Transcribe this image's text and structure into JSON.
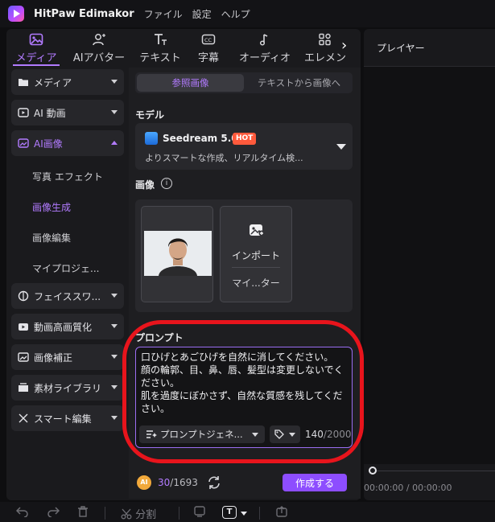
{
  "app": {
    "title": "HitPaw Edimakor",
    "menu": [
      "ファイル",
      "設定",
      "ヘルプ"
    ]
  },
  "tool_tabs": [
    {
      "label": "メディア",
      "icon": "media-icon",
      "active": true
    },
    {
      "label": "AIアバター",
      "icon": "ai-avatar-icon",
      "active": false
    },
    {
      "label": "テキスト",
      "icon": "text-icon",
      "active": false
    },
    {
      "label": "字幕",
      "icon": "subtitle-icon",
      "active": false
    },
    {
      "label": "オーディオ",
      "icon": "audio-icon",
      "active": false
    },
    {
      "label": "エレメン",
      "icon": "element-icon",
      "active": false
    }
  ],
  "sidebar": {
    "items": [
      {
        "label": "メディア",
        "icon": "folder-icon"
      },
      {
        "label": "AI 動画",
        "icon": "ai-video-icon"
      },
      {
        "label": "AI画像",
        "icon": "ai-image-icon",
        "expanded": true
      },
      {
        "label": "フェイススワ...",
        "icon": "face-swap-icon"
      },
      {
        "label": "動画高画質化",
        "icon": "video-enhance-icon"
      },
      {
        "label": "画像補正",
        "icon": "image-fix-icon"
      },
      {
        "label": "素材ライブラリ",
        "icon": "library-icon"
      },
      {
        "label": "スマート編集",
        "icon": "smart-edit-icon"
      }
    ],
    "subitems": [
      {
        "label": "写真 エフェクト"
      },
      {
        "label": "画像生成",
        "active": true
      },
      {
        "label": "画像編集"
      },
      {
        "label": "マイプロジェ..."
      }
    ]
  },
  "panel": {
    "segments": [
      "参照画像",
      "テキストから画像へ"
    ],
    "model_label": "モデル",
    "model": {
      "name": "Seedream 5.0",
      "badge": "HOT",
      "description": "よりスマートな作成、リアルタイム検..."
    },
    "image_label": "画像",
    "info_glyph": "i",
    "import_label": "インポート",
    "import_sub": "マイ...ター",
    "prompt_label": "プロンプト",
    "prompt_text": "口ひげとあごひげを自然に消してください。\n顔の輪郭、目、鼻、唇、髪型は変更しないでください。\n肌を過度にぼかさず、自然な質感を残してください。",
    "prompt_generator": "プロンプトジェネ...",
    "char_count": "140",
    "char_max": "/2000",
    "credits_badge": "AI",
    "credits_used": "30",
    "credits_total": "/1693",
    "create_button": "作成する"
  },
  "player": {
    "title": "プレイヤー",
    "time": "00:00:00 / 00:00:00"
  },
  "bottom": {
    "split_label": "分割",
    "t_label": "T"
  },
  "colors": {
    "accent": "#b27bff",
    "create": "#8d4dff",
    "hot": "#ff5a3c",
    "highlight": "#e8141c"
  }
}
